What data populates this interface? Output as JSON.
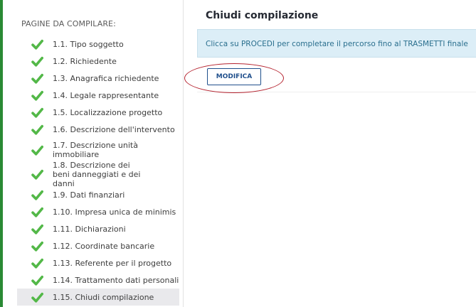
{
  "sidebar": {
    "title": "PAGINE DA COMPILARE:",
    "items": [
      {
        "label": "1.1. Tipo soggetto"
      },
      {
        "label": "1.2. Richiedente"
      },
      {
        "label": "1.3. Anagrafica richiedente"
      },
      {
        "label": "1.4. Legale rappresentante"
      },
      {
        "label": "1.5. Localizzazione progetto"
      },
      {
        "label": "1.6. Descrizione dell'intervento"
      },
      {
        "label": "1.7. Descrizione unità immobiliare"
      },
      {
        "label": "1.8. Descrizione dei beni danneggiati e dei danni"
      },
      {
        "label": "1.9. Dati finanziari"
      },
      {
        "label": "1.10. Impresa unica de minimis"
      },
      {
        "label": "1.11. Dichiarazioni"
      },
      {
        "label": "1.12. Coordinate bancarie"
      },
      {
        "label": "1.13. Referente per il progetto"
      },
      {
        "label": "1.14. Trattamento dati personali"
      },
      {
        "label": "1.15. Chiudi compilazione"
      }
    ],
    "item_status_icon": "checkmark-icon",
    "active_item_index": 14
  },
  "main": {
    "title": "Chiudi compilazione",
    "info_message": "Clicca su PROCEDI per completare il percorso fino al TRASMETTI finale",
    "modify_button_label": "MODIFICA"
  },
  "colors": {
    "check_green": "#53b848",
    "sidebar_accent": "#2a8a34",
    "info_bg": "#dceef7",
    "info_text": "#2a6f8e",
    "button_border": "#1f4f8c",
    "annotation_red": "#b5232f",
    "active_item_bg": "#e9e9ec"
  }
}
